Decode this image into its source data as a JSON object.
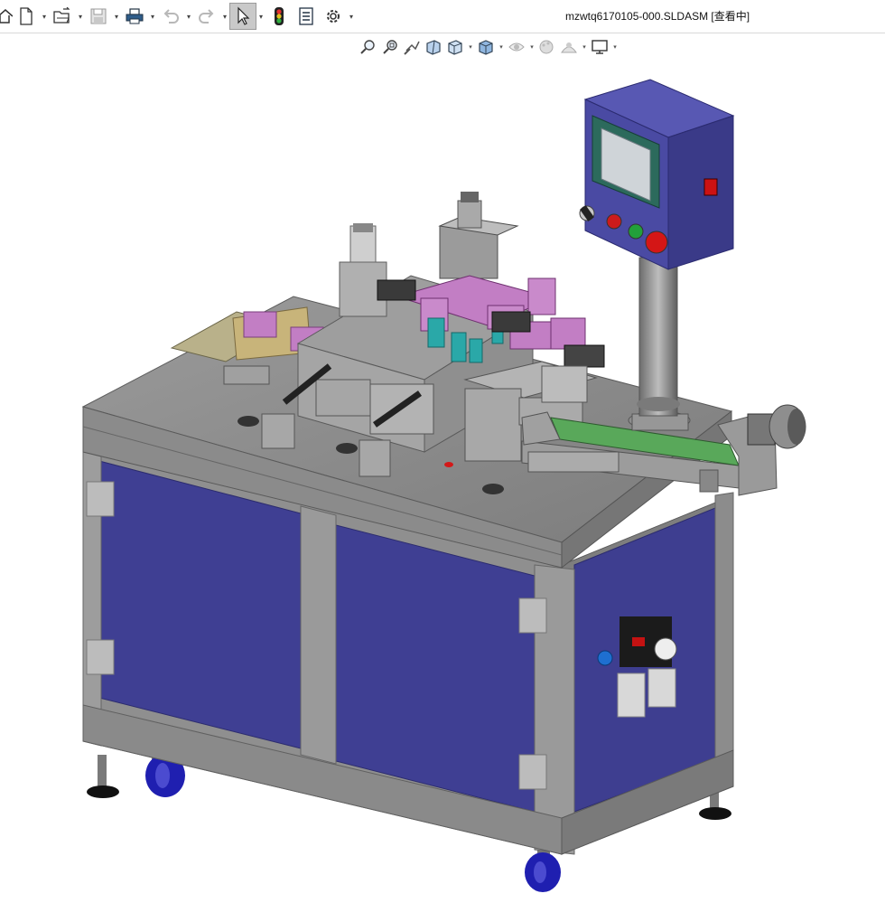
{
  "app": {
    "document_title": "mzwtq6170105-000.SLDASM [查看中]"
  },
  "toolbar": {
    "buttons": [
      {
        "name": "home-icon",
        "dropdown": false
      },
      {
        "name": "new-document-icon",
        "dropdown": true
      },
      {
        "name": "open-folder-icon",
        "dropdown": true
      },
      {
        "name": "save-icon",
        "dropdown": true
      },
      {
        "name": "print-icon",
        "dropdown": true
      },
      {
        "name": "undo-icon",
        "dropdown": true
      },
      {
        "name": "redo-icon",
        "dropdown": true
      },
      {
        "name": "select-cursor-icon",
        "dropdown": true,
        "active": true
      },
      {
        "name": "rebuild-traffic-light-icon",
        "dropdown": false
      },
      {
        "name": "file-properties-icon",
        "dropdown": false
      },
      {
        "name": "options-gear-icon",
        "dropdown": true
      }
    ]
  },
  "view_toolbar": {
    "buttons": [
      {
        "name": "zoom-to-fit-icon"
      },
      {
        "name": "zoom-to-area-icon"
      },
      {
        "name": "previous-view-icon"
      },
      {
        "name": "section-view-icon"
      },
      {
        "name": "view-orientation-icon",
        "dropdown": true
      },
      {
        "name": "display-style-icon",
        "dropdown": true
      },
      {
        "name": "hide-show-items-icon",
        "dropdown": true
      },
      {
        "name": "edit-appearance-icon"
      },
      {
        "name": "apply-scene-icon",
        "dropdown": true
      },
      {
        "name": "view-settings-monitor-icon",
        "dropdown": true
      }
    ]
  },
  "colors": {
    "panel_blue": "#3f3f93",
    "frame_gray": "#8e8e8e",
    "conveyor_green": "#59a85a",
    "fixture_pink": "#c27ec4",
    "cyan_part": "#2aa8a8",
    "caster_blue": "#2727b8",
    "stop_red": "#d01818"
  },
  "model": {
    "name": "assembly-3d-model"
  }
}
